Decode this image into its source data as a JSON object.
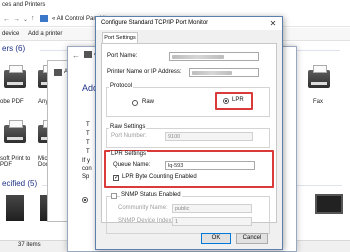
{
  "background_window": {
    "title": "ces and Printers",
    "address": "« All Control Panel Items",
    "toolbar": {
      "device_label": "device",
      "add_printer_label": "Add a printer"
    },
    "sections": {
      "printers_heading": "ers (6)",
      "unspecified_heading": "ecified (5)"
    },
    "devices": [
      {
        "label": "obe PDF"
      },
      {
        "label": "AnyD"
      },
      {
        "label": "Fax"
      },
      {
        "label": "soft Print to\nPDF"
      },
      {
        "label": "Mic\nDocu"
      }
    ],
    "status": {
      "items_count": "37 items"
    }
  },
  "wizard": {
    "title": "Add",
    "lines": [
      "T",
      "T",
      "T",
      "T",
      "If y",
      "con",
      "Sp"
    ],
    "row_label": "Ad"
  },
  "wizard2": {
    "row_label": "Ad"
  },
  "dialog": {
    "title": "Configure Standard TCP/IP Port Monitor",
    "close_glyph": "✕",
    "tab_label": "Port Settings",
    "port_name_label": "Port Name:",
    "port_name_value": "",
    "printer_name_label": "Printer Name or IP Address:",
    "printer_name_value": "",
    "protocol": {
      "group_title": "Protocol",
      "raw_label": "Raw",
      "lpr_label": "LPR",
      "selected": "LPR"
    },
    "raw_settings": {
      "group_title": "Raw Settings",
      "port_number_label": "Port Number:",
      "port_number_value": "9100"
    },
    "lpr_settings": {
      "group_title": "LPR Settings",
      "queue_name_label": "Queue Name:",
      "queue_name_value": "lq-593",
      "byte_counting_label": "LPR Byte Counting Enabled",
      "byte_counting_checked": true
    },
    "snmp": {
      "group_title": "SNMP Status Enabled",
      "community_label": "Community Name:",
      "community_value": "public",
      "device_index_label": "SNMP Device Index:",
      "device_index_value": "1"
    },
    "buttons": {
      "ok": "OK",
      "cancel": "Cancel"
    }
  },
  "colors": {
    "highlight": "#d93a3a",
    "accent": "#0078d7",
    "section_heading": "#1e3287"
  }
}
